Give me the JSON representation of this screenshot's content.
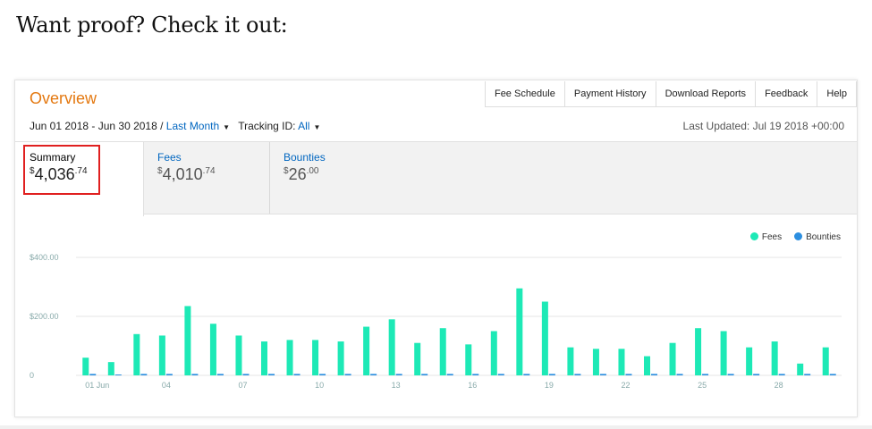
{
  "heading": "Want proof? Check it out:",
  "overview": {
    "title": "Overview",
    "nav": [
      "Fee Schedule",
      "Payment History",
      "Download Reports",
      "Feedback",
      "Help"
    ],
    "date_range": "Jun 01 2018 - Jun 30 2018 /",
    "period_link": "Last Month",
    "tracking_label": "Tracking ID:",
    "tracking_value": "All",
    "last_updated": "Last Updated: Jul 19 2018 +00:00"
  },
  "tabs": {
    "summary": {
      "label": "Summary",
      "currency": "$",
      "whole": "4,036",
      "cents": ".74"
    },
    "fees": {
      "label": "Fees",
      "currency": "$",
      "whole": "4,010",
      "cents": ".74"
    },
    "bounties": {
      "label": "Bounties",
      "currency": "$",
      "whole": "26",
      "cents": ".00"
    }
  },
  "colors": {
    "fees": "#1de9b6",
    "bounties": "#2d8fe0",
    "accent": "#e47911",
    "highlight": "#e02020"
  },
  "chart_data": {
    "type": "bar",
    "x": [
      1,
      2,
      3,
      4,
      5,
      6,
      7,
      8,
      9,
      10,
      11,
      12,
      13,
      14,
      15,
      16,
      17,
      18,
      19,
      20,
      21,
      22,
      23,
      24,
      25,
      26,
      27,
      28,
      29,
      30
    ],
    "x_tick_labels": [
      {
        "day": 1,
        "label": "01 Jun"
      },
      {
        "day": 4,
        "label": "04"
      },
      {
        "day": 7,
        "label": "07"
      },
      {
        "day": 10,
        "label": "10"
      },
      {
        "day": 13,
        "label": "13"
      },
      {
        "day": 16,
        "label": "16"
      },
      {
        "day": 19,
        "label": "19"
      },
      {
        "day": 22,
        "label": "22"
      },
      {
        "day": 25,
        "label": "25"
      },
      {
        "day": 28,
        "label": "28"
      }
    ],
    "y_ticks": [
      {
        "value": 0,
        "label": "0"
      },
      {
        "value": 200,
        "label": "$200.00"
      },
      {
        "value": 400,
        "label": "$400.00"
      }
    ],
    "ylim": [
      0,
      400
    ],
    "grid": true,
    "legend_position": "top-right",
    "series": [
      {
        "name": "Fees",
        "values": [
          60,
          45,
          140,
          135,
          235,
          175,
          135,
          115,
          120,
          120,
          115,
          165,
          190,
          110,
          160,
          105,
          150,
          295,
          250,
          95,
          90,
          90,
          65,
          110,
          160,
          150,
          95,
          115,
          40,
          95
        ]
      },
      {
        "name": "Bounties",
        "values": [
          5,
          3,
          5,
          5,
          5,
          5,
          5,
          5,
          5,
          5,
          5,
          5,
          5,
          5,
          5,
          5,
          5,
          5,
          5,
          5,
          5,
          5,
          5,
          5,
          5,
          5,
          5,
          5,
          5,
          5
        ]
      }
    ]
  }
}
